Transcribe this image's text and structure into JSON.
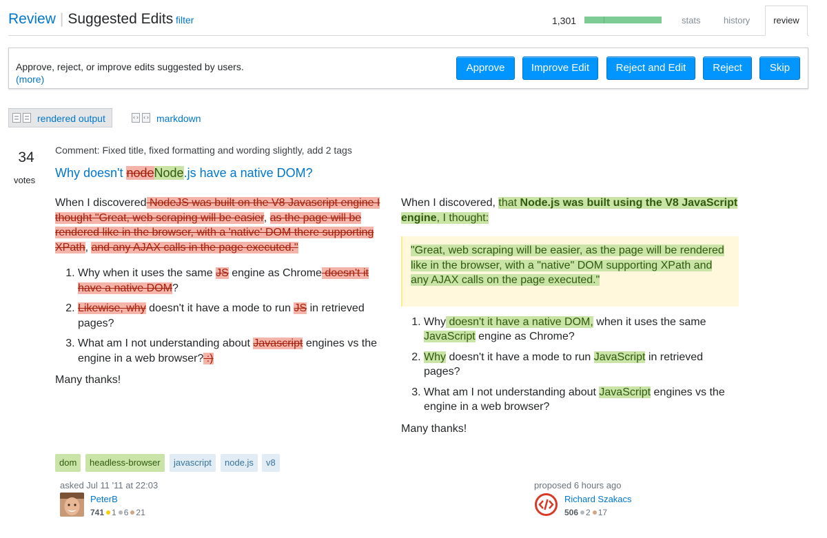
{
  "header": {
    "title_review": "Review",
    "title_section": "Suggested Edits",
    "filter": "filter",
    "count": "1,301",
    "progress": 1.0,
    "tabs": [
      "stats",
      "history",
      "review"
    ]
  },
  "actions": {
    "description": "Approve, reject, or improve edits suggested by users.",
    "more": "(more)",
    "buttons": [
      "Approve",
      "Improve Edit",
      "Reject and Edit",
      "Reject",
      "Skip"
    ]
  },
  "view": {
    "rendered_label": "rendered output",
    "markdown_label": "markdown"
  },
  "post": {
    "votes": "34",
    "votes_label": "votes",
    "comment": "Comment: Fixed title, fixed formatting and wording slightly, add 2 tags",
    "title_prefix": "Why doesn't ",
    "title_removed": "node",
    "title_added": "Node",
    "title_suffix": ".js have a native DOM?"
  },
  "left": {
    "p1": [
      "When I discovered",
      " NodeJS was built on the V8 Javascript engine I thought \"Great, web scraping will be easier",
      ", ",
      "as the page will be rendered like in the browser, with a 'native' DOM there supporting XPath",
      ", ",
      "and any AJAX calls in the page executed.\""
    ],
    "li1": [
      "Why when it uses the same ",
      "JS",
      " engine as Chrome",
      " doesn't it have a native DOM",
      "?"
    ],
    "li2": [
      "Likewise, why",
      " doesn't it have a mode to run ",
      "JS",
      " in retrieved pages?"
    ],
    "li3": [
      "What am I not understanding about ",
      "Javascript",
      " engines vs the engine in a web browser?",
      " :)"
    ],
    "closing": "Many thanks!"
  },
  "right": {
    "p1": [
      "When I discovered, ",
      "that ",
      "Node.js was built using the V8 JavaScript engine",
      ", I thought:"
    ],
    "quote": "\"Great, web scraping will be easier, as the page will be rendered like in the browser, with a \"native\" DOM supporting XPath and any AJAX calls on the page executed.\"",
    "li1": [
      "Why",
      " doesn't it have a native DOM,",
      " when it uses the same ",
      "JavaScript",
      " engine as Chrome?"
    ],
    "li2": [
      "Why",
      " doesn't it have a mode to run ",
      "JavaScript",
      " in retrieved pages?"
    ],
    "li3": [
      "What am I not understanding about ",
      "JavaScript",
      " engines vs the engine in a web browser?"
    ],
    "closing": "Many thanks!"
  },
  "tags": [
    {
      "name": "dom",
      "added": true
    },
    {
      "name": "headless-browser",
      "added": true
    },
    {
      "name": "javascript",
      "added": false
    },
    {
      "name": "node.js",
      "added": false
    },
    {
      "name": "v8",
      "added": false
    }
  ],
  "asker": {
    "caption": "asked Jul 11 '11 at 22:03",
    "name": "PeterB",
    "rep": "741",
    "gold": "1",
    "silver": "6",
    "bronze": "21"
  },
  "proposer": {
    "caption": "proposed 6 hours ago",
    "name": "Richard Szakacs",
    "rep": "506",
    "silver": "2",
    "bronze": "17"
  }
}
